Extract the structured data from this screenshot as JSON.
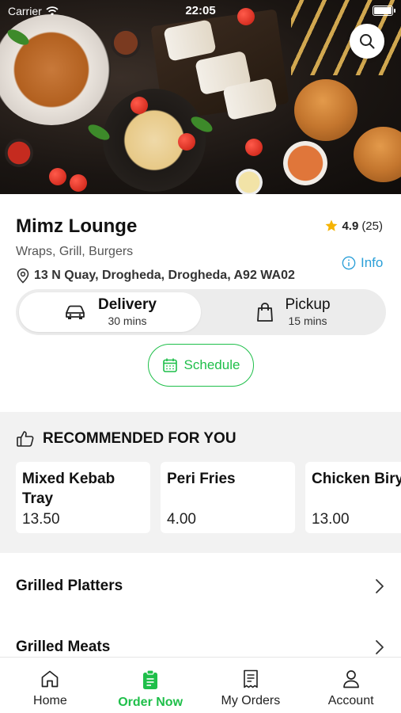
{
  "status_bar": {
    "carrier": "Carrier",
    "time": "22:05"
  },
  "restaurant": {
    "name": "Mimz Lounge",
    "rating": "4.9",
    "rating_count": "(25)",
    "cuisine": "Wraps, Grill, Burgers",
    "address": "13 N Quay, Drogheda, Drogheda, A92 WA02",
    "info_label": "Info"
  },
  "modes": {
    "delivery": {
      "label": "Delivery",
      "time": "30 mins",
      "selected": true
    },
    "pickup": {
      "label": "Pickup",
      "time": "15 mins",
      "selected": false
    }
  },
  "schedule_label": "Schedule",
  "recommended": {
    "title": "RECOMMENDED FOR YOU",
    "items": [
      {
        "name": "Mixed Kebab Tray",
        "price": "13.50"
      },
      {
        "name": "Peri Fries",
        "price": "4.00"
      },
      {
        "name": "Chicken Biryani",
        "price": "13.00"
      }
    ]
  },
  "categories": [
    {
      "name": "Grilled Platters"
    },
    {
      "name": "Grilled Meats"
    }
  ],
  "tabs": [
    {
      "label": "Home",
      "icon": "home-icon"
    },
    {
      "label": "Order Now",
      "icon": "order-bag-icon",
      "active": true
    },
    {
      "label": "My Orders",
      "icon": "receipt-icon"
    },
    {
      "label": "Account",
      "icon": "user-icon"
    }
  ],
  "colors": {
    "accent_green": "#1fbf4a",
    "info_blue": "#2a9fd8",
    "star": "#f5b301"
  }
}
